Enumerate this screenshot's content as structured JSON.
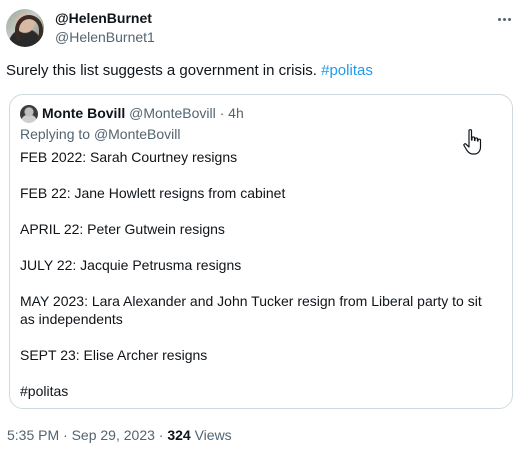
{
  "author": {
    "name": "@HelenBurnet",
    "handle": "@HelenBurnet1"
  },
  "tweet": {
    "text": "Surely this list suggests a government in crisis. ",
    "hashtag": "#politas"
  },
  "quote": {
    "name": "Monte Bovill",
    "handle": "@MonteBovill",
    "separator": " · ",
    "time": "4h",
    "replying_prefix": "Replying to ",
    "replying_handle": "@MonteBovill",
    "lines": [
      "FEB 2022: Sarah Courtney resigns",
      "FEB 22: Jane Howlett resigns from cabinet",
      "APRIL 22: Peter Gutwein resigns",
      "JULY 22: Jacquie Petrusma resigns",
      "MAY 2023: Lara Alexander and John Tucker resign from Liberal party to sit as independents",
      "SEPT 23: Elise Archer resigns",
      "#politas"
    ]
  },
  "footer": {
    "time": "5:35 PM",
    "sep": " · ",
    "date": "Sep 29, 2023",
    "views_count": "324",
    "views_label": " Views"
  },
  "icons": {
    "more": "more-horizontal-icon",
    "cursor": "hand-pointer-icon"
  },
  "colors": {
    "link": "#1d9bf0",
    "muted": "#536471",
    "text": "#0f1419",
    "border": "#cfd9de"
  }
}
